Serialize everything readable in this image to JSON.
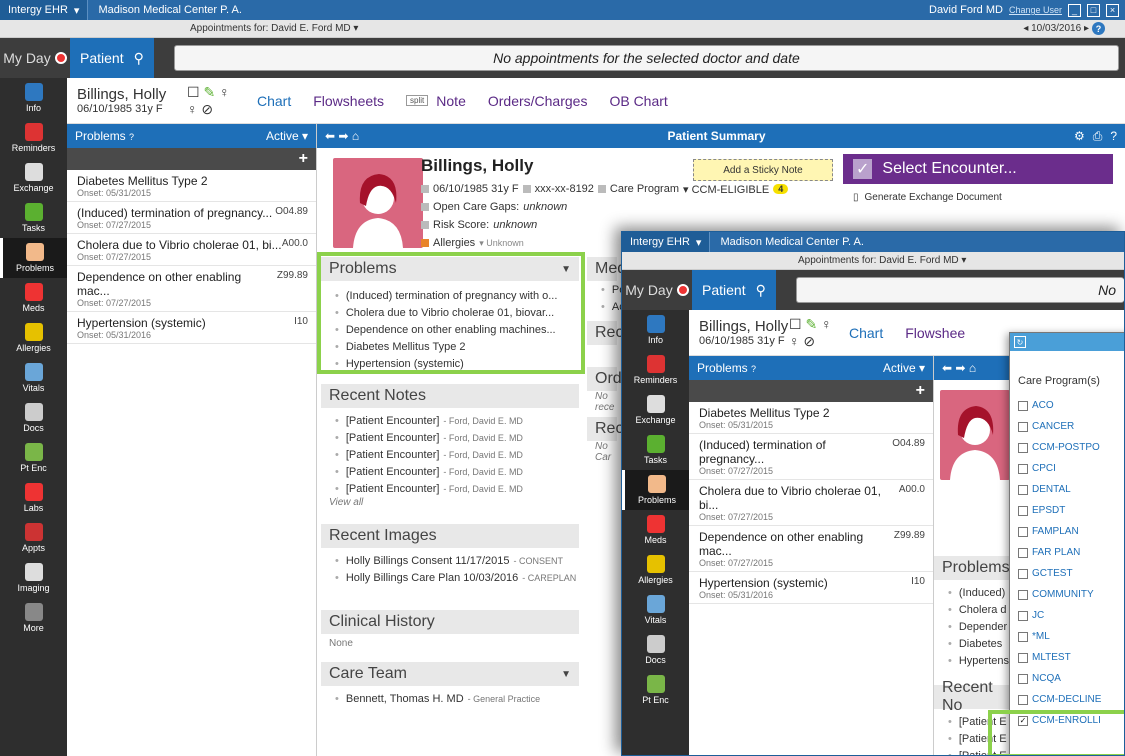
{
  "window": {
    "app_menu": "Intergy EHR",
    "title": "Madison Medical Center P. A.",
    "user": "David Ford MD",
    "change_user": "Change User"
  },
  "appointments": {
    "label": "Appointments for:",
    "doctor": "David E. Ford MD",
    "date": "10/03/2016",
    "message": "No appointments for the selected doctor and date"
  },
  "nav": {
    "my_day": "My Day",
    "patient": "Patient"
  },
  "sidebar": {
    "items": [
      {
        "label": "Info",
        "icon": "info-icon",
        "color": "#2e78c0"
      },
      {
        "label": "Reminders",
        "icon": "reminders-icon",
        "color": "#d33"
      },
      {
        "label": "Exchange",
        "icon": "exchange-icon",
        "color": "#ddd"
      },
      {
        "label": "Tasks",
        "icon": "tasks-icon",
        "color": "#5bb030"
      },
      {
        "label": "Problems",
        "icon": "problems-icon",
        "color": "#f2b98a"
      },
      {
        "label": "Meds",
        "icon": "meds-icon",
        "color": "#e33"
      },
      {
        "label": "Allergies",
        "icon": "allergies-icon",
        "color": "#e6c100"
      },
      {
        "label": "Vitals",
        "icon": "vitals-icon",
        "color": "#6aa6d8"
      },
      {
        "label": "Docs",
        "icon": "docs-icon",
        "color": "#ccc"
      },
      {
        "label": "Pt Enc",
        "icon": "pt-enc-icon",
        "color": "#7ab648"
      },
      {
        "label": "Labs",
        "icon": "labs-icon",
        "color": "#e33"
      },
      {
        "label": "Appts",
        "icon": "appts-icon",
        "color": "#c33"
      },
      {
        "label": "Imaging",
        "icon": "imaging-icon",
        "color": "#ddd"
      },
      {
        "label": "More",
        "icon": "more-icon",
        "color": "#888"
      }
    ]
  },
  "patient": {
    "name": "Billings, Holly",
    "dob_age_sex": "06/10/1985 31y F",
    "ssn": "xxx-xx-8192",
    "care_program_label": "Care Program",
    "care_program_value": "CCM-ELIGIBLE",
    "care_program_count": "4",
    "open_care_gaps": "Open Care Gaps:",
    "open_care_gaps_value": "unknown",
    "risk_score": "Risk Score:",
    "risk_score_value": "unknown",
    "allergies": "Allergies",
    "allergies_value": "Unknown"
  },
  "tabs": {
    "chart": "Chart",
    "flowsheets": "Flowsheets",
    "split": "split",
    "note": "Note",
    "orders": "Orders/Charges",
    "ob_chart": "OB Chart"
  },
  "problems_panel": {
    "title": "Problems",
    "filter": "Active",
    "items": [
      {
        "name": "Diabetes Mellitus Type 2",
        "code": "",
        "onset": "Onset: 05/31/2015"
      },
      {
        "name": "(Induced) termination of pregnancy...",
        "code": "O04.89",
        "onset": "Onset: 07/27/2015"
      },
      {
        "name": "Cholera due to Vibrio cholerae 01, bi...",
        "code": "A00.0",
        "onset": "Onset: 07/27/2015"
      },
      {
        "name": "Dependence on other enabling mac...",
        "code": "Z99.89",
        "onset": "Onset: 07/27/2015"
      },
      {
        "name": "Hypertension (systemic)",
        "code": "I10",
        "onset": "Onset: 05/31/2016"
      }
    ]
  },
  "summary": {
    "title": "Patient Summary",
    "sticky": "Add a Sticky Note",
    "encounter": "Select Encounter...",
    "generate": "Generate Exchange Document",
    "problems_title": "Problems",
    "problems": [
      "(Induced) termination of pregnancy with o...",
      "Cholera due to Vibrio cholerae 01, biovar...",
      "Dependence on other enabling machines...",
      "Diabetes Mellitus Type 2",
      "Hypertension (systemic)"
    ],
    "meds_title": "Med",
    "meds_items": [
      "Pe",
      "Ac"
    ],
    "recent_title": "Rece",
    "orders_title": "Orde",
    "orders_note": "No rece",
    "recent2_title": "Rece",
    "recent2_note": "No Car",
    "notes_title": "Recent Notes",
    "notes": [
      {
        "main": "[Patient Encounter]",
        "sub": "- Ford, David E. MD"
      },
      {
        "main": "[Patient Encounter]",
        "sub": "- Ford, David E. MD"
      },
      {
        "main": "[Patient Encounter]",
        "sub": "- Ford, David E. MD"
      },
      {
        "main": "[Patient Encounter]",
        "sub": "- Ford, David E. MD"
      },
      {
        "main": "[Patient Encounter]",
        "sub": "- Ford, David E. MD"
      }
    ],
    "view_all": "View all",
    "images_title": "Recent Images",
    "images": [
      {
        "main": "Holly Billings Consent 11/17/2015",
        "sub": "- CONSENT"
      },
      {
        "main": "Holly Billings Care Plan 10/03/2016",
        "sub": "- CAREPLAN"
      }
    ],
    "history_title": "Clinical History",
    "history_note": "None",
    "careteam_title": "Care Team",
    "careteam": [
      {
        "main": "Bennett, Thomas H. MD",
        "sub": "- General Practice"
      }
    ]
  },
  "window2": {
    "recent_notes_title": "Recent No",
    "problems_title": "Problems",
    "problems_short": [
      "(Induced)",
      "Cholera d",
      "Depender",
      "Diabetes",
      "Hypertens"
    ],
    "notes_short": [
      "[Patient E",
      "[Patient E",
      "[Patient E",
      "[Patient E"
    ],
    "apptmsg_short": "No",
    "flowsheets_short": "Flowshee"
  },
  "care_dialog": {
    "caption": "Care Program(s)",
    "programs": [
      {
        "label": "ACO",
        "checked": false
      },
      {
        "label": "CANCER",
        "checked": false
      },
      {
        "label": "CCM-POSTPO",
        "checked": false
      },
      {
        "label": "CPCI",
        "checked": false
      },
      {
        "label": "DENTAL",
        "checked": false
      },
      {
        "label": "EPSDT",
        "checked": false
      },
      {
        "label": "FAMPLAN",
        "checked": false
      },
      {
        "label": "FAR PLAN",
        "checked": false
      },
      {
        "label": "GCTEST",
        "checked": false
      },
      {
        "label": "COMMUNITY",
        "checked": false
      },
      {
        "label": "JC",
        "checked": false
      },
      {
        "label": "*ML",
        "checked": false
      },
      {
        "label": "MLTEST",
        "checked": false
      },
      {
        "label": "NCQA",
        "checked": false
      },
      {
        "label": "CCM-DECLINE",
        "checked": false
      },
      {
        "label": "CCM-ENROLLI",
        "checked": true
      }
    ]
  },
  "colors": {
    "titlebar": "#2a6aa8",
    "accent": "#1e6fb8",
    "highlight": "#8cd14b",
    "encounter": "#6b2d8c"
  }
}
